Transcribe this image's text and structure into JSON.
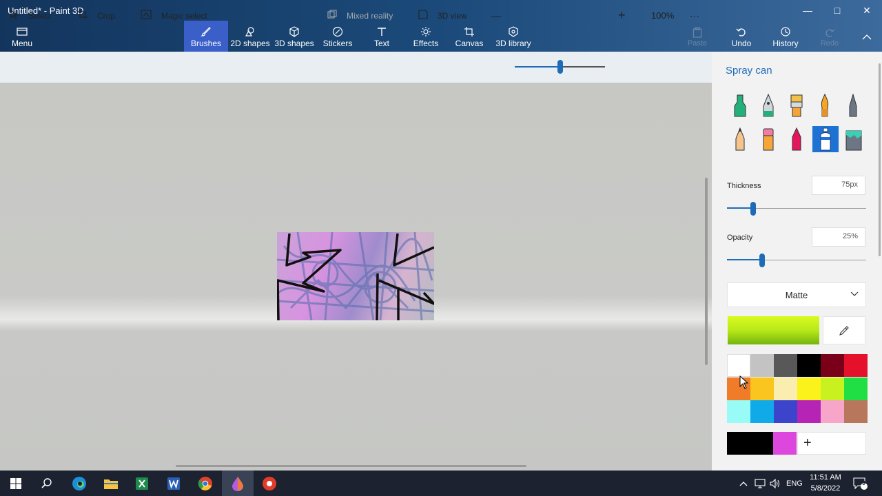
{
  "window": {
    "title": "Untitled* - Paint 3D",
    "controls": {
      "minimize": "—",
      "maximize": "□",
      "close": "✕"
    }
  },
  "ribbon": {
    "menu_label": "Menu",
    "tabs": [
      {
        "label": "Brushes",
        "icon": "brush-icon",
        "active": true
      },
      {
        "label": "2D shapes",
        "icon": "2d-shapes-icon"
      },
      {
        "label": "3D shapes",
        "icon": "3d-shapes-icon"
      },
      {
        "label": "Stickers",
        "icon": "stickers-icon"
      },
      {
        "label": "Text",
        "icon": "text-icon"
      },
      {
        "label": "Effects",
        "icon": "effects-icon"
      },
      {
        "label": "Canvas",
        "icon": "canvas-icon"
      },
      {
        "label": "3D library",
        "icon": "3d-library-icon"
      }
    ],
    "actions": {
      "paste": "Paste",
      "undo": "Undo",
      "history": "History",
      "redo": "Redo"
    }
  },
  "toolbar": {
    "select": "Select",
    "crop": "Crop",
    "magic_select": "Magic select",
    "mixed_reality": "Mixed reality",
    "view_3d": "3D view",
    "zoom_out": "—",
    "zoom_in": "+",
    "zoom": "100%",
    "more": "···",
    "zoom_level": 0.5
  },
  "panel": {
    "title": "Spray can",
    "brushes": [
      "marker-icon",
      "calligraphy-pen-icon",
      "oil-brush-icon",
      "watercolor-icon",
      "pixel-pen-icon",
      "pencil-icon",
      "eraser-icon",
      "crayon-icon",
      "spray-can-icon",
      "fill-icon"
    ],
    "selected_brush": "spray-can-icon",
    "thickness_label": "Thickness",
    "thickness_value": "75px",
    "thickness_level": 0.19,
    "opacity_label": "Opacity",
    "opacity_value": "25%",
    "opacity_level": 0.25,
    "material": "Matte",
    "current_color": "#b8e818",
    "palette": [
      "#ffffff",
      "#c3c3c3",
      "#585858",
      "#000000",
      "#7a0019",
      "#e5112b",
      "#f07b28",
      "#f9c51e",
      "#f9eeb0",
      "#fcf21b",
      "#c9f11f",
      "#1fdf45",
      "#98fbf6",
      "#10aae9",
      "#3d44cc",
      "#b624b5",
      "#f7a5c9",
      "#b8775c"
    ],
    "custom_colors": [
      "#000000",
      "#dd47dd"
    ],
    "add_color": "+"
  },
  "taskbar": {
    "time": "11:51 AM",
    "date": "5/8/2022",
    "language": "ENG",
    "notification_count": "9"
  }
}
